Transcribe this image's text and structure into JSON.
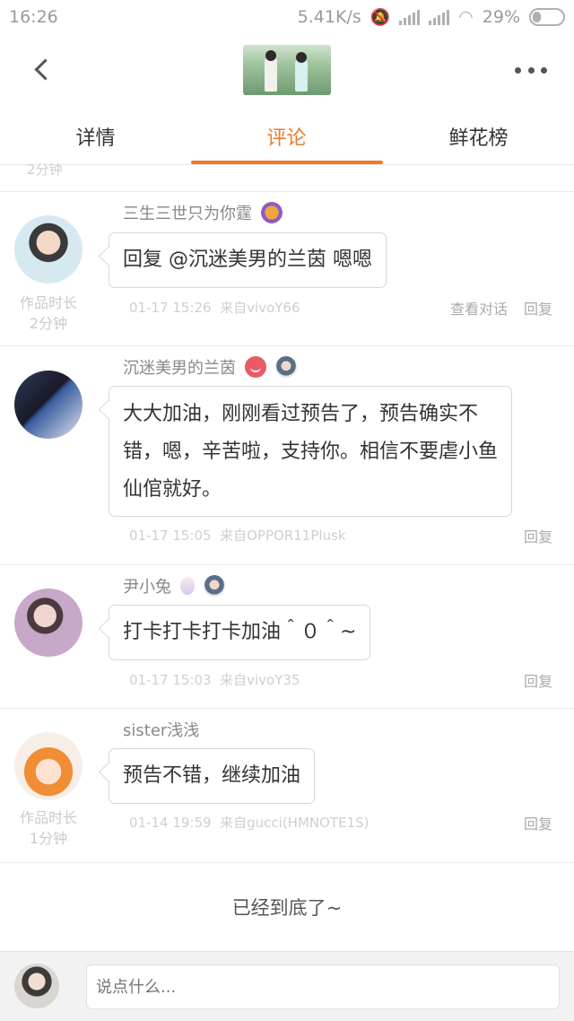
{
  "status_bar": {
    "time": "16:26",
    "network_speed": "5.41K/s",
    "battery": "29%"
  },
  "header": {
    "back_icon": "back-arrow-icon",
    "more_icon": "more-dots-icon"
  },
  "tabs": [
    {
      "label": "详情",
      "active": false
    },
    {
      "label": "评论",
      "active": true
    },
    {
      "label": "鲜花榜",
      "active": false
    }
  ],
  "accent_color": "#ef7a2a",
  "partial_top": "2分钟",
  "comments": [
    {
      "username": "三生三世只为你霆",
      "duration_label": "作品时长",
      "duration_value": "2分钟",
      "text": "回复 @沉迷美男的兰茵 嗯嗯",
      "time": "01-17 15:26",
      "source": "来自vivoY66",
      "view_dialog": "查看对话",
      "reply": "回复"
    },
    {
      "username": "沉迷美男的兰茵",
      "text_lines": [
        "大大加油，刚刚看过预告了，预告确实不",
        "错，嗯，辛苦啦，支持你。相信不要虐小鱼",
        "仙倌就好。"
      ],
      "time": "01-17 15:05",
      "source": "来自OPPOR11Plusk",
      "reply": "回复"
    },
    {
      "username": "尹小兔",
      "text": "打卡打卡打卡加油＾０＾~",
      "time": "01-17 15:03",
      "source": "来自vivoY35",
      "reply": "回复"
    },
    {
      "username": "sister浅浅",
      "duration_label": "作品时长",
      "duration_value": "1分钟",
      "text": "预告不错，继续加油",
      "time": "01-14 19:59",
      "source": "来自gucci(HMNOTE1S)",
      "reply": "回复"
    }
  ],
  "end_text": "已经到底了~",
  "input": {
    "placeholder": "说点什么..."
  }
}
